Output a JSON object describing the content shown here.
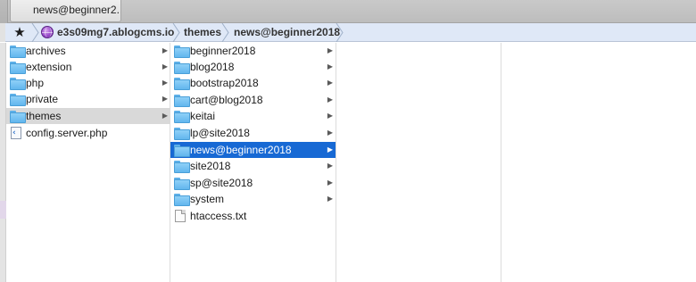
{
  "window": {
    "tab_title": "news@beginner2..."
  },
  "pathbar": {
    "favorite_icon": "star-icon",
    "server_icon": "globe-icon",
    "crumbs": [
      "e3s09mg7.ablogcms.io",
      "themes",
      "news@beginner2018"
    ]
  },
  "columns": {
    "root": [
      {
        "label": "archives",
        "icon": "folder-icon",
        "has_children": true
      },
      {
        "label": "extension",
        "icon": "folder-icon",
        "has_children": true
      },
      {
        "label": "php",
        "icon": "folder-icon",
        "has_children": true
      },
      {
        "label": "private",
        "icon": "folder-icon",
        "has_children": true
      },
      {
        "label": "themes",
        "icon": "folder-icon",
        "has_children": true,
        "selected": true
      },
      {
        "label": "config.server.php",
        "icon": "php-file-icon",
        "has_children": false
      }
    ],
    "themes": [
      {
        "label": "beginner2018",
        "icon": "folder-icon",
        "has_children": true
      },
      {
        "label": "blog2018",
        "icon": "folder-icon",
        "has_children": true
      },
      {
        "label": "bootstrap2018",
        "icon": "folder-icon",
        "has_children": true
      },
      {
        "label": "cart@blog2018",
        "icon": "folder-icon",
        "has_children": true
      },
      {
        "label": "keitai",
        "icon": "folder-icon",
        "has_children": true
      },
      {
        "label": "lp@site2018",
        "icon": "folder-icon",
        "has_children": true
      },
      {
        "label": "news@beginner2018",
        "icon": "folder-icon",
        "has_children": true,
        "selected": true
      },
      {
        "label": "site2018",
        "icon": "folder-icon",
        "has_children": true
      },
      {
        "label": "sp@site2018",
        "icon": "folder-icon",
        "has_children": true
      },
      {
        "label": "system",
        "icon": "folder-icon",
        "has_children": true
      },
      {
        "label": "htaccess.txt",
        "icon": "text-file-icon",
        "has_children": false
      }
    ],
    "news_beginner2018": [],
    "empty": []
  },
  "colors": {
    "selection_active": "#1769d4",
    "selection_inactive": "#d9d9d9",
    "pathbar_background": "#dfe8f7"
  }
}
